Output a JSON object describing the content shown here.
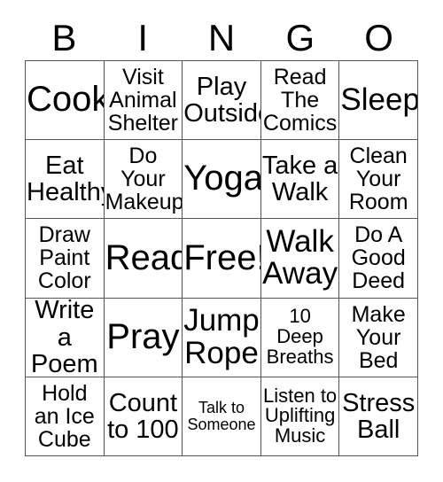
{
  "card": {
    "title": "BINGO",
    "header_letters": [
      "B",
      "I",
      "N",
      "G",
      "O"
    ],
    "free_space_label": "Free!",
    "colors": {
      "text": "#000000",
      "border": "#555555",
      "background": "#ffffff"
    },
    "grid": {
      "columns": 5,
      "rows": 5,
      "cells": [
        {
          "text": "Cook",
          "size": "fs-xl"
        },
        {
          "text": "Visit\nAnimal\nShelter",
          "size": "fs-sm"
        },
        {
          "text": "Play\nOutside",
          "size": "fs-md"
        },
        {
          "text": "Read\nThe\nComics",
          "size": "fs-sm"
        },
        {
          "text": "Sleep",
          "size": "fs-lg"
        },
        {
          "text": "Eat\nHealthy",
          "size": "fs-md"
        },
        {
          "text": "Do Your\nMakeup",
          "size": "fs-sm"
        },
        {
          "text": "Yoga",
          "size": "fs-xl"
        },
        {
          "text": "Take a\nWalk",
          "size": "fs-md"
        },
        {
          "text": "Clean\nYour\nRoom",
          "size": "fs-sm"
        },
        {
          "text": "Draw\nPaint\nColor",
          "size": "fs-sm"
        },
        {
          "text": "Read",
          "size": "fs-xl"
        },
        {
          "text": "Free!",
          "size": "fs-xl"
        },
        {
          "text": "Walk\nAway",
          "size": "fs-lg"
        },
        {
          "text": "Do A\nGood\nDeed",
          "size": "fs-sm"
        },
        {
          "text": "Write a\nPoem",
          "size": "fs-md"
        },
        {
          "text": "Pray",
          "size": "fs-xl"
        },
        {
          "text": "Jump\nRope",
          "size": "fs-lg"
        },
        {
          "text": "10\nDeep\nBreaths",
          "size": "fs-xs"
        },
        {
          "text": "Make\nYour\nBed",
          "size": "fs-sm"
        },
        {
          "text": "Hold\nan Ice\nCube",
          "size": "fs-sm"
        },
        {
          "text": "Count\nto 100",
          "size": "fs-md"
        },
        {
          "text": "Talk to\nSomeone",
          "size": "fs-xxs"
        },
        {
          "text": "Listen to\nUplifting\nMusic",
          "size": "fs-xs"
        },
        {
          "text": "Stress\nBall",
          "size": "fs-md"
        }
      ]
    }
  }
}
